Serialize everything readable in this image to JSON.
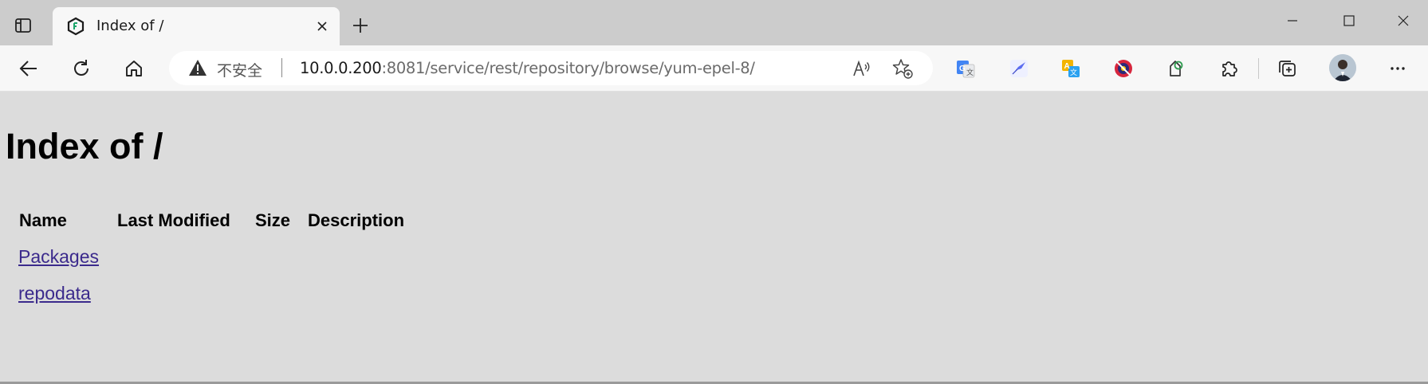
{
  "browser": {
    "tab": {
      "title": "Index of /",
      "favicon": "nexus-repository-icon"
    },
    "address_bar": {
      "security_label": "不安全",
      "url_host": "10.0.0.200",
      "url_path": ":8081/service/rest/repository/browse/yum-epel-8/"
    },
    "extensions": [
      "google-translate-icon",
      "feather-extension-icon",
      "translate-extension-icon",
      "blocked-extension-icon",
      "tag-extension-icon",
      "extensions-puzzle-icon"
    ]
  },
  "page": {
    "title": "Index of /",
    "table": {
      "columns": [
        "Name",
        "Last Modified",
        "Size",
        "Description"
      ],
      "rows": [
        {
          "name": "Packages",
          "last_modified": "",
          "size": "",
          "description": ""
        },
        {
          "name": "repodata",
          "last_modified": "",
          "size": "",
          "description": ""
        }
      ]
    }
  },
  "colors": {
    "page_background": "#dcdcdc",
    "link_visited": "#3b2a8c",
    "tabstrip": "#cccccc",
    "toolbar": "#f7f7f7"
  }
}
